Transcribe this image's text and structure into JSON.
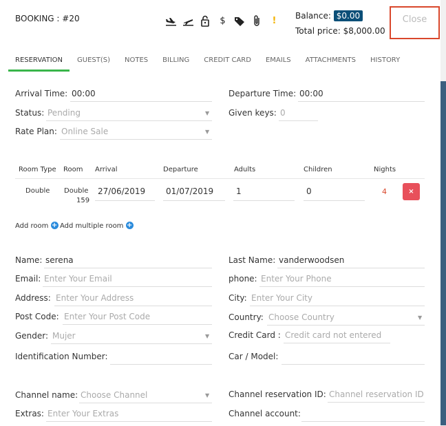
{
  "header": {
    "booking_title": "BOOKING : #20",
    "balance_label": "Balance:",
    "balance_value": "$0.00",
    "total_label": "Total price: $8,000.00",
    "close_label": "Close",
    "icons": [
      "arrival-plane-icon",
      "departure-plane-icon",
      "lock-icon",
      "dollar-icon",
      "tags-icon",
      "paperclip-icon",
      "warning-icon"
    ]
  },
  "tabs": [
    "RESERVATION",
    "GUEST(S)",
    "NOTES",
    "BILLING",
    "CREDIT CARD",
    "EMAILS",
    "ATTACHMENTS",
    "HISTORY"
  ],
  "reservation": {
    "arrival_time_label": "Arrival Time:",
    "arrival_time_value": "00:00",
    "departure_time_label": "Departure Time:",
    "departure_time_value": "00:00",
    "status_label": "Status:",
    "status_value": "Pending",
    "given_keys_label": "Given keys:",
    "given_keys_value": "0",
    "rate_plan_label": "Rate Plan:",
    "rate_plan_value": "Online Sale"
  },
  "rooms_table": {
    "headers": [
      "Room Type",
      "Room",
      "Arrival",
      "Departure",
      "Adults",
      "Children",
      "Nights"
    ],
    "row": {
      "room_type": "Double",
      "room_line1": "Double",
      "room_line2": "159",
      "arrival": "27/06/2019",
      "departure": "01/07/2019",
      "adults": "1",
      "children": "0",
      "nights": "4",
      "delete_icon": "×"
    },
    "add_room": "Add room",
    "add_multiple_room": "Add multiple room"
  },
  "guest": {
    "name_label": "Name:",
    "name_value": "serena",
    "last_name_label": "Last Name:",
    "last_name_value": "vanderwoodsen",
    "email_label": "Email:",
    "email_placeholder": "Enter Your Email",
    "phone_label": "phone:",
    "phone_placeholder": "Enter Your Phone",
    "address_label": "Address:",
    "address_placeholder": "Enter Your Address",
    "city_label": "City:",
    "city_placeholder": "Enter Your City",
    "post_code_label": "Post Code:",
    "post_code_placeholder": "Enter Your Post Code",
    "country_label": "Country:",
    "country_placeholder": "Choose Country",
    "gender_label": "Gender:",
    "gender_value": "Mujer",
    "credit_card_label": "Credit Card :",
    "credit_card_placeholder": "Credit card not entered",
    "identification_label": "Identification Number:",
    "car_label": "Car / Model:"
  },
  "channel": {
    "channel_name_label": "Channel name:",
    "channel_name_placeholder": "Choose Channel",
    "channel_reservation_label": "Channel reservation ID:",
    "channel_reservation_placeholder": "Channel reservation ID",
    "extras_label": "Extras:",
    "extras_placeholder": "Enter Your Extras",
    "channel_account_label": "Channel account:"
  }
}
